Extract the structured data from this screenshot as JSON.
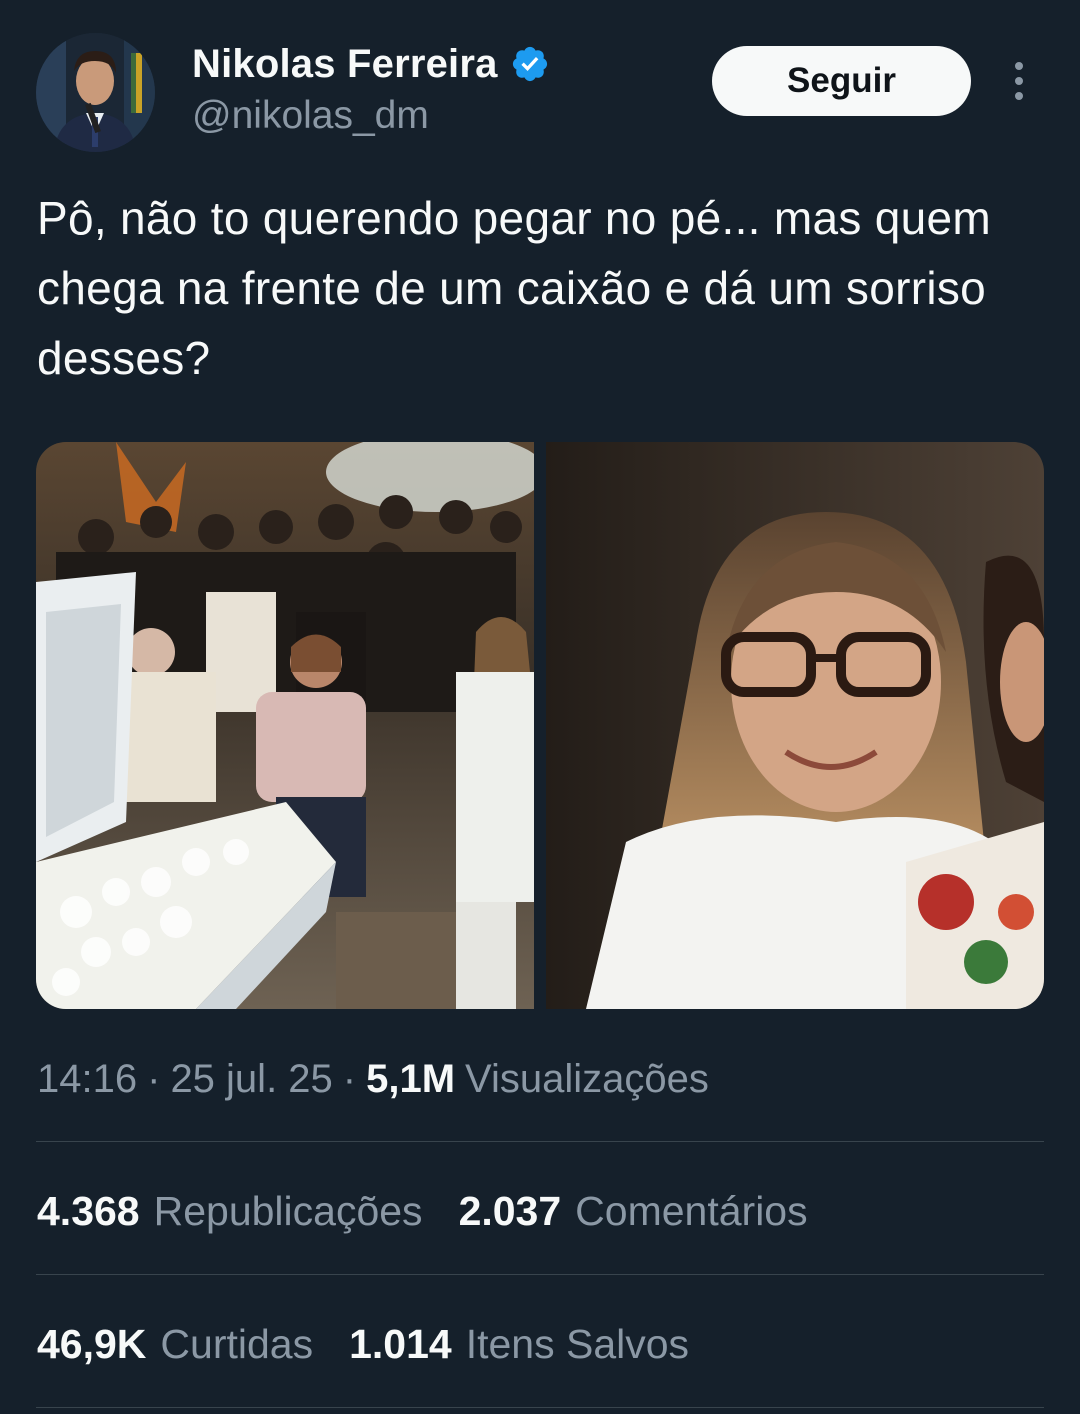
{
  "author": {
    "display_name": "Nikolas Ferreira",
    "handle": "@nikolas_dm",
    "verified_icon": "verified-badge-icon",
    "badge_color": "#1d9bf0"
  },
  "actions": {
    "follow_label": "Seguir",
    "more_icon": "more-vertical-icon"
  },
  "tweet": {
    "text": "Pô, não to querendo pegar no pé... mas quem chega na frente de um caixão e dá um sorriso desses?"
  },
  "meta": {
    "time": "14:16",
    "sep1": "·",
    "date": "25 jul. 25",
    "sep2": "·",
    "views_count": "5,1M",
    "views_label": "Visualizações"
  },
  "stats": {
    "reposts_count": "4.368",
    "reposts_label": "Republicações",
    "comments_count": "2.037",
    "comments_label": "Comentários",
    "likes_count": "46,9K",
    "likes_label": "Curtidas",
    "saves_count": "1.014",
    "saves_label": "Itens Salvos"
  },
  "colors": {
    "background": "#15202b",
    "text_primary": "#f7f9f9",
    "text_secondary": "#8b98a5",
    "divider": "#38444d"
  }
}
